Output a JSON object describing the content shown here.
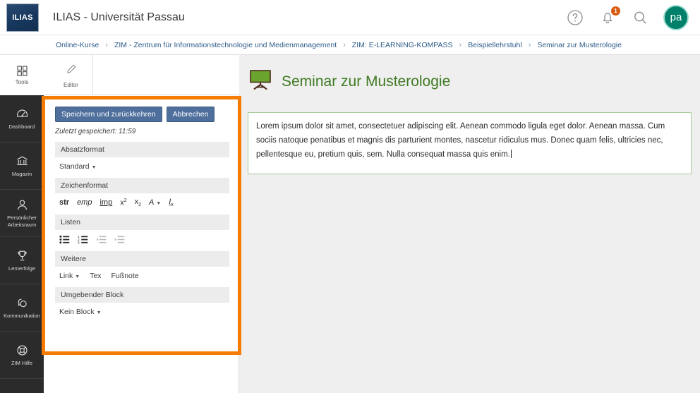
{
  "header": {
    "logo_text": "ILIAS",
    "app_title": "ILIAS - Universität Passau",
    "help_icon": "help-circle-icon",
    "notification_icon": "bell-icon",
    "notification_count": "1",
    "search_icon": "search-icon",
    "avatar_initials": "pa",
    "colors": {
      "avatar_bg": "#00806a",
      "badge_bg": "#d95b0f",
      "logo_bg": "#17375e"
    }
  },
  "breadcrumb": {
    "separator": "›",
    "items": [
      "Online-Kurse",
      "ZIM - Zentrum für Informationstechnologie und Medienmanagement",
      "ZIM: E-LEARNING-KOMPASS",
      "Beispiellehrstuhl",
      "Seminar zur Musterologie"
    ]
  },
  "rail": {
    "tools_label": "Tools",
    "items": [
      {
        "label": "Dashboard",
        "icon": "dashboard-icon"
      },
      {
        "label": "Magazin",
        "icon": "bank-icon"
      },
      {
        "label": "Persönlicher Arbeitsraum",
        "icon": "user-icon"
      },
      {
        "label": "Lernerfolge",
        "icon": "trophy-icon"
      },
      {
        "label": "Kommunikation",
        "icon": "chat-icon"
      },
      {
        "label": "ZIM Hilfe",
        "icon": "lifebuoy-icon"
      }
    ]
  },
  "tabs": {
    "editor_label": "Editor",
    "editor_icon": "pencil-icon"
  },
  "editor_panel": {
    "highlight_color": "#f57c00",
    "save_button": "Speichern und zurückkehren",
    "cancel_button": "Abbrechen",
    "last_saved": "Zuletzt gespeichert: 11:59",
    "sections": {
      "paragraph_format": {
        "title": "Absatzformat",
        "selected": "Standard"
      },
      "character_format": {
        "title": "Zeichenformat",
        "buttons": [
          "str",
          "emp",
          "imp",
          "x2",
          "x2sub",
          "A",
          "Ix"
        ]
      },
      "lists": {
        "title": "Listen",
        "buttons": [
          "unordered-list",
          "ordered-list",
          "outdent",
          "indent"
        ]
      },
      "more": {
        "title": "Weitere",
        "buttons": [
          "Link",
          "Tex",
          "Fußnote"
        ]
      },
      "surrounding_block": {
        "title": "Umgebender Block",
        "selected": "Kein Block"
      }
    }
  },
  "main": {
    "page_title": "Seminar zur Musterologie",
    "page_icon": "chalkboard-icon",
    "title_color": "#3f7a23",
    "content_text": "Lorem ipsum dolor sit amet, consectetuer adipiscing elit. Aenean commodo ligula eget dolor. Aenean massa. Cum sociis natoque penatibus et magnis dis parturient montes, nascetur ridiculus mus. Donec quam felis, ultricies nec, pellentesque eu, pretium quis, sem. Nulla consequat massa quis enim.",
    "edit_border_color": "#a8c99a"
  }
}
